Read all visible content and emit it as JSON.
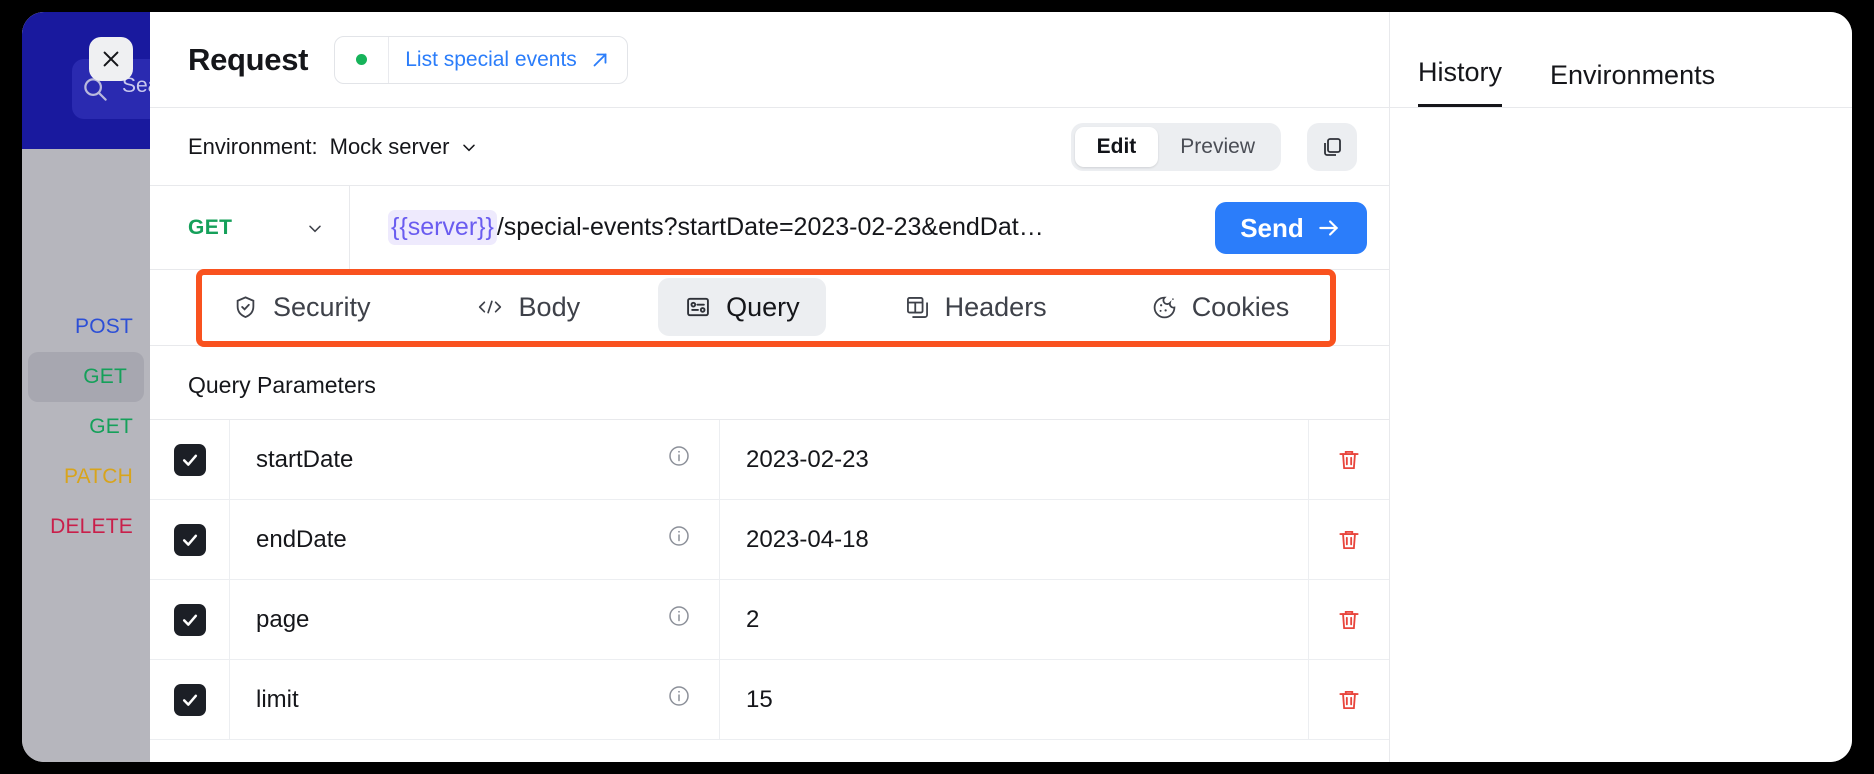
{
  "sidebar": {
    "search_placeholder": "Search",
    "close_label": "×",
    "methods": [
      {
        "label": "POST",
        "selected": false
      },
      {
        "label": "GET",
        "selected": true
      },
      {
        "label": "GET",
        "selected": false
      },
      {
        "label": "PATCH",
        "selected": false
      },
      {
        "label": "DELETE",
        "selected": false
      }
    ]
  },
  "request": {
    "title": "Request",
    "chip_label": "List special events",
    "status_color": "#16b35a"
  },
  "environment": {
    "label": "Environment:",
    "value": "Mock server",
    "edit_label": "Edit",
    "preview_label": "Preview"
  },
  "url": {
    "method": "GET",
    "variable": "{{server}}",
    "path": "/special-events?startDate=2023-02-23&endDat…",
    "send_label": "Send"
  },
  "tabs": [
    {
      "label": "Security",
      "icon": "shield-check-icon",
      "active": false
    },
    {
      "label": "Body",
      "icon": "code-icon",
      "active": false
    },
    {
      "label": "Query",
      "icon": "query-card-icon",
      "active": true
    },
    {
      "label": "Headers",
      "icon": "headers-icon",
      "active": false
    },
    {
      "label": "Cookies",
      "icon": "cookie-icon",
      "active": false
    }
  ],
  "highlight_color": "#f9521f",
  "query_parameters": {
    "title": "Query Parameters",
    "rows": [
      {
        "enabled": true,
        "name": "startDate",
        "value": "2023-02-23"
      },
      {
        "enabled": true,
        "name": "endDate",
        "value": "2023-04-18"
      },
      {
        "enabled": true,
        "name": "page",
        "value": "2"
      },
      {
        "enabled": true,
        "name": "limit",
        "value": "15"
      }
    ]
  },
  "right_panel": {
    "tabs": [
      {
        "label": "History",
        "active": true
      },
      {
        "label": "Environments",
        "active": false
      }
    ]
  }
}
